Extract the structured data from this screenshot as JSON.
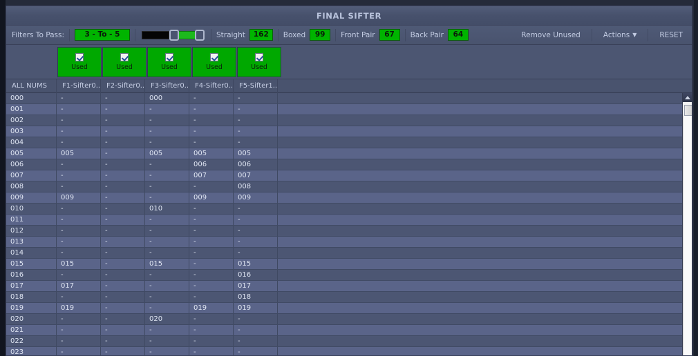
{
  "window": {
    "title": "FINAL SIFTER"
  },
  "toolbar": {
    "filters_label": "Filters To Pass:",
    "filters_value": "3 - To - 5",
    "slider": {
      "name": "range-slider",
      "low_handle": 3,
      "high_handle": 5
    },
    "stats": [
      {
        "name": "straight",
        "label": "Straight",
        "value": "162"
      },
      {
        "name": "boxed",
        "label": "Boxed",
        "value": "99"
      },
      {
        "name": "front-pair",
        "label": "Front Pair",
        "value": "67"
      },
      {
        "name": "back-pair",
        "label": "Back Pair",
        "value": "64"
      }
    ],
    "remove_unused_label": "Remove Unused",
    "actions_label": "Actions",
    "actions_caret": "▼",
    "reset_label": "RESET"
  },
  "used_row": {
    "label": "Used",
    "columns": [
      {
        "name": "used-f1",
        "checked": true
      },
      {
        "name": "used-f2",
        "checked": true
      },
      {
        "name": "used-f3",
        "checked": true
      },
      {
        "name": "used-f4",
        "checked": true
      },
      {
        "name": "used-f5",
        "checked": true
      }
    ]
  },
  "grid": {
    "headers": [
      "ALL NUMS",
      "F1-Sifter0...",
      "F2-Sifter0...",
      "F3-Sifter0...",
      "F4-Sifter0...",
      "F5-Sifter1...",
      ""
    ],
    "rows": [
      [
        "000",
        "-",
        "-",
        "000",
        "-",
        "-",
        ""
      ],
      [
        "001",
        "-",
        "-",
        "-",
        "-",
        "-",
        ""
      ],
      [
        "002",
        "-",
        "-",
        "-",
        "-",
        "-",
        ""
      ],
      [
        "003",
        "-",
        "-",
        "-",
        "-",
        "-",
        ""
      ],
      [
        "004",
        "-",
        "-",
        "-",
        "-",
        "-",
        ""
      ],
      [
        "005",
        "005",
        "-",
        "005",
        "005",
        "005",
        ""
      ],
      [
        "006",
        "-",
        "-",
        "-",
        "006",
        "006",
        ""
      ],
      [
        "007",
        "-",
        "-",
        "-",
        "007",
        "007",
        ""
      ],
      [
        "008",
        "-",
        "-",
        "-",
        "-",
        "008",
        ""
      ],
      [
        "009",
        "009",
        "-",
        "-",
        "009",
        "009",
        ""
      ],
      [
        "010",
        "-",
        "-",
        "010",
        "-",
        "-",
        ""
      ],
      [
        "011",
        "-",
        "-",
        "-",
        "-",
        "-",
        ""
      ],
      [
        "012",
        "-",
        "-",
        "-",
        "-",
        "-",
        ""
      ],
      [
        "013",
        "-",
        "-",
        "-",
        "-",
        "-",
        ""
      ],
      [
        "014",
        "-",
        "-",
        "-",
        "-",
        "-",
        ""
      ],
      [
        "015",
        "015",
        "-",
        "015",
        "-",
        "015",
        ""
      ],
      [
        "016",
        "-",
        "-",
        "-",
        "-",
        "016",
        ""
      ],
      [
        "017",
        "017",
        "-",
        "-",
        "-",
        "017",
        ""
      ],
      [
        "018",
        "-",
        "-",
        "-",
        "-",
        "018",
        ""
      ],
      [
        "019",
        "019",
        "-",
        "-",
        "019",
        "019",
        ""
      ],
      [
        "020",
        "-",
        "-",
        "020",
        "-",
        "-",
        ""
      ],
      [
        "021",
        "-",
        "-",
        "-",
        "-",
        "-",
        ""
      ],
      [
        "022",
        "-",
        "-",
        "-",
        "-",
        "-",
        ""
      ],
      [
        "023",
        "-",
        "-",
        "-",
        "-",
        "-",
        ""
      ]
    ]
  },
  "scrollbar": {
    "up_arrow": "▲",
    "position_pct": 2
  },
  "colors": {
    "accent_green": "#00b400",
    "panel_bg": "#4e5873",
    "row_odd": "#4c5673",
    "row_even": "#5a6489",
    "text": "#dfe5f2"
  }
}
